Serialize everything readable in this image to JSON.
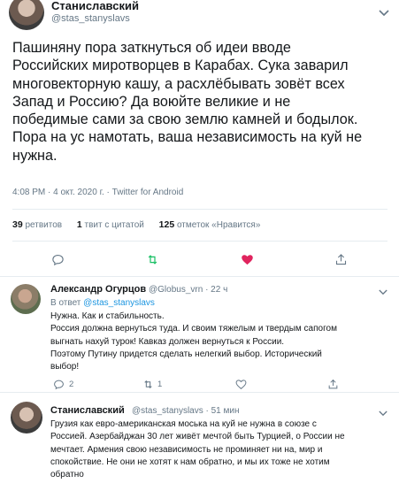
{
  "main_tweet": {
    "author_name": "Станиславский",
    "author_handle": "@stas_stanyslavs",
    "text": "Пашиняну пора заткнуться об идеи вводе\nРоссийских миротворцев в Карабах. Сука заварил\nмноговекторную кашу, а расхлёбывать зовёт всех\nЗапад и Россию? Да воюйте великие и не\nпобедимые сами за свою землю камней и бодылок.\nПора на ус намотать, ваша независимость на куй не\nнужна.",
    "meta": "4:08 PM · 4 окт. 2020 г. · Twitter for Android",
    "stats": {
      "retweets_count": "39",
      "retweets_label": "ретвитов",
      "quotes_count": "1",
      "quotes_label": "твит с цитатой",
      "likes_count": "125",
      "likes_label": "отметок «Нравится»"
    }
  },
  "replies": [
    {
      "name": "Александр Огурцов",
      "handle": "@Globus_vrn · 22 ч",
      "in_reply_prefix": "В ответ",
      "in_reply_handle": "@stas_stanyslavs",
      "text": "Нужна. Как и стабильность.\nРоссия должна вернуться туда. И своим тяжелым и твердым сапогом\nвыгнать нахуй турок! Кавказ должен вернуться к России.\nПоэтому Путину придется сделать нелегкий выбор. Исторический\nвыбор!",
      "reply_count": "2",
      "retweet_count": "1"
    },
    {
      "name": "Станиславский",
      "handle": "@stas_stanyslavs · 51 мин",
      "text": "Грузия как евро-американская моська на куй не нужна в союзе с\nРоссией. Азербайджан 30 лет живёт мечтой быть Турцией, о России не\nмечтает. Армения свою независимость не проминяет ни на, мир и\nспокойствие. Не они не хотят к нам обратно, и мы их тоже не хотим\nобратно"
    }
  ],
  "colors": {
    "accent_blue": "#1b95e0",
    "retweet_green": "#17bf63",
    "like_red": "#e0245e",
    "muted": "#657786"
  }
}
